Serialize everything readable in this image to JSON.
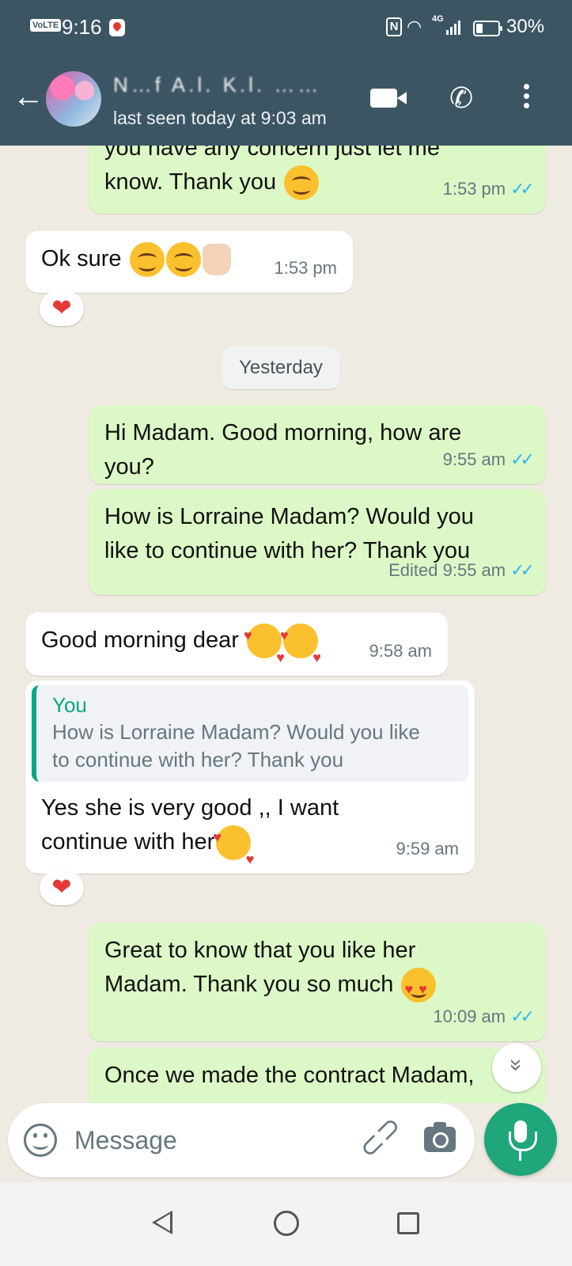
{
  "status_bar": {
    "network_badge": "VoLTE",
    "time": "9:16",
    "network_type": "4G",
    "battery": "30%",
    "icons": [
      "location-icon",
      "nfc-icon",
      "wifi-icon",
      "signal-icon",
      "battery-icon"
    ]
  },
  "header": {
    "contact_name": "N…f A.l. K.l.  ……",
    "last_seen": "last seen today at 9:03 am",
    "icons": [
      "back-arrow-icon",
      "video-call-icon",
      "voice-call-icon",
      "more-vert-icon"
    ]
  },
  "messages": [
    {
      "id": "m1",
      "direction": "outgoing",
      "text_line1": "you have any concern just let me",
      "text_line2": "know. Thank you",
      "emoji": "smiling-face",
      "time": "1:53 pm",
      "ticks": "✓✓"
    },
    {
      "id": "m2",
      "direction": "incoming",
      "text": "Ok sure",
      "emoji": "smiling-face smiling-face thumbs-up",
      "time": "1:53 pm",
      "reaction": "❤"
    },
    {
      "id": "m3",
      "direction": "outgoing",
      "text_line1": "Hi Madam. Good morning, how are",
      "text_line2": "you?",
      "time": "9:55 am",
      "ticks": "✓✓"
    },
    {
      "id": "m4",
      "direction": "outgoing",
      "text_line1": "How is Lorraine Madam? Would you",
      "text_line2": "like to continue with her? Thank you",
      "edited_label": "Edited",
      "time": "9:55 am",
      "ticks": "✓✓"
    },
    {
      "id": "m5",
      "direction": "incoming",
      "text": "Good morning dear",
      "emoji": "smiling-face-with-hearts x2",
      "time": "9:58 am"
    },
    {
      "id": "m6",
      "direction": "incoming",
      "quote_author": "You",
      "quote_line1": "How is Lorraine Madam? Would you like",
      "quote_line2": "to continue with her? Thank you",
      "text_line1": "Yes she is very good ,, I want",
      "text_line2": "continue with her",
      "emoji": "smiling-face-with-hearts",
      "time": "9:59 am",
      "reaction": "❤"
    },
    {
      "id": "m7",
      "direction": "outgoing",
      "text_line1": "Great to know that you like her",
      "text_line2": "Madam. Thank you so much",
      "emoji": "heart-eyes",
      "time": "10:09 am",
      "ticks": "✓✓"
    },
    {
      "id": "m8",
      "direction": "outgoing",
      "text_line1": "Once we made the contract Madam,"
    }
  ],
  "date_separator": "Yesterday",
  "composer": {
    "placeholder": "Message",
    "icons": [
      "emoji-icon",
      "attach-icon",
      "camera-icon",
      "mic-icon"
    ]
  },
  "scroll_down_icon": "»",
  "nav_bar": {
    "icons": [
      "nav-back-icon",
      "nav-home-icon",
      "nav-recents-icon"
    ]
  },
  "colors": {
    "header_bg": "#3c5563",
    "outgoing_bubble": "#dcf8c6",
    "incoming_bubble": "#ffffff",
    "chat_bg": "#efeae2",
    "accent_green": "#1fa67a",
    "read_ticks": "#34b7f1",
    "quote_accent": "#07a882"
  }
}
